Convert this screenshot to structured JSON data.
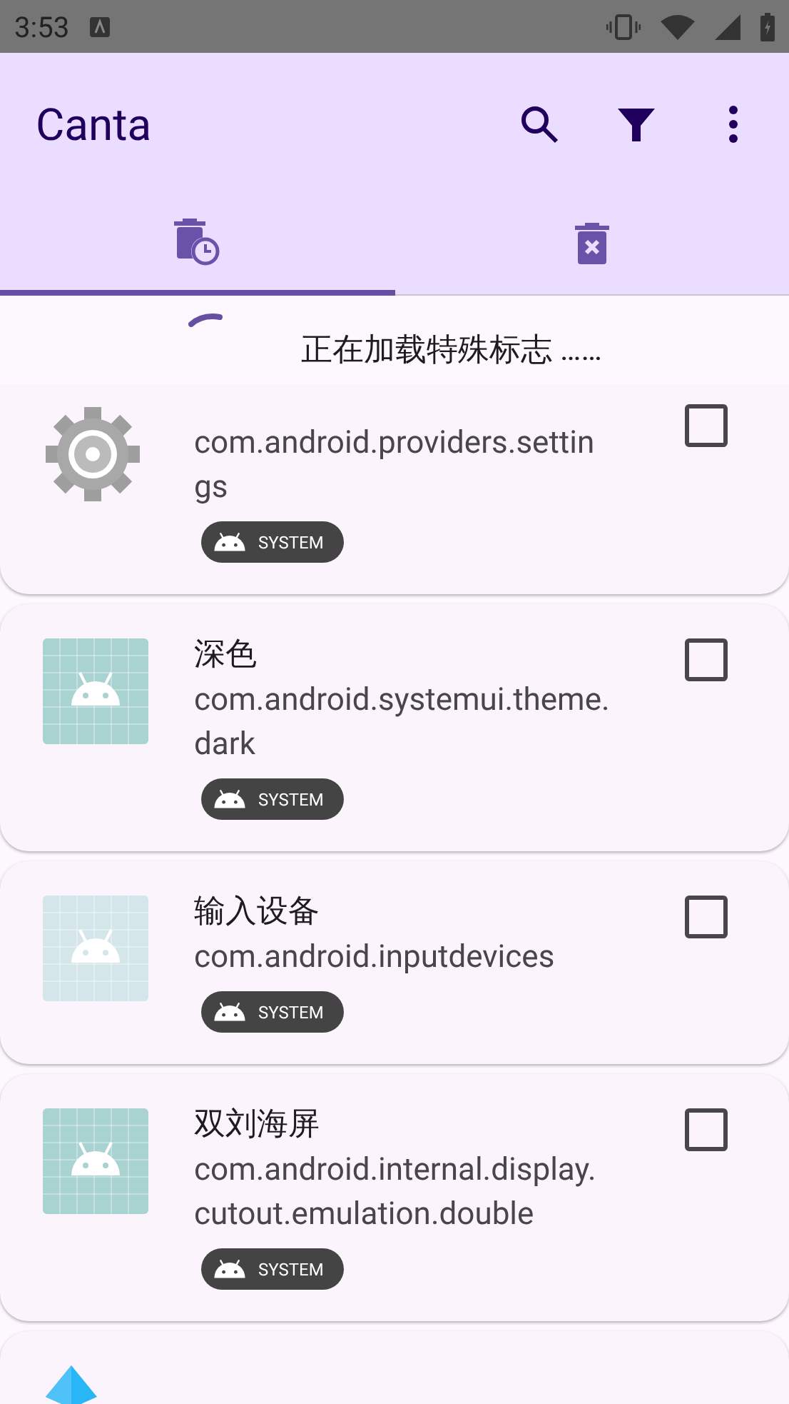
{
  "status_bar": {
    "time": "3:53"
  },
  "app_bar": {
    "title": "Canta"
  },
  "tabs": [
    {
      "kind": "trash-clock",
      "selected": true
    },
    {
      "kind": "trash-x",
      "selected": false
    }
  ],
  "loading": {
    "text": "正在加载特殊标志 ……"
  },
  "apps": [
    {
      "kind": "gear",
      "package": "com.android.providers.settings",
      "badge": "SYSTEM",
      "checked": false
    },
    {
      "kind": "android",
      "name": "深色",
      "package": "com.android.systemui.theme.dark",
      "badge": "SYSTEM",
      "checked": false
    },
    {
      "kind": "android-light",
      "name": "输入设备",
      "package": "com.android.inputdevices",
      "badge": "SYSTEM",
      "checked": false
    },
    {
      "kind": "android",
      "name": "双刘海屏",
      "package": "com.android.internal.display.cutout.emulation.double",
      "badge": "SYSTEM",
      "checked": false
    },
    {
      "kind": "gem"
    }
  ]
}
